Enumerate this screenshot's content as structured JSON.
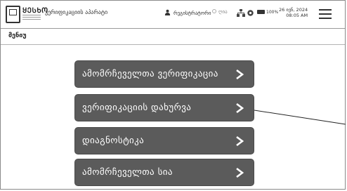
{
  "header": {
    "logo_text": "ᲧᲔᲡᲮᲝ",
    "app_title": "ვერიფიკაციის აპარატი",
    "user_label": "რეგისტრატორი",
    "status_label": "ღია",
    "battery_label": "100%",
    "date": "26 ივნ, 2024",
    "time": "08:05 AM"
  },
  "breadcrumb": {
    "label": "მენიუ"
  },
  "menu": {
    "items": [
      {
        "label": "ამომრჩეველთა ვერიფიკაცია"
      },
      {
        "label": "ვერიფიკაციის დახურვა"
      },
      {
        "label": "დიაგნოსტიკა"
      },
      {
        "label": "ამომრჩეველთა სია"
      }
    ]
  },
  "colors": {
    "button_bg": "#5b5b5b",
    "button_text": "#ffffff",
    "border": "#8a8a8a"
  },
  "icons": [
    "logo-icon",
    "user-icon",
    "status-dot-icon",
    "network-icon",
    "gear-icon",
    "battery-icon",
    "hamburger-menu-icon",
    "chevron-right-icon"
  ]
}
